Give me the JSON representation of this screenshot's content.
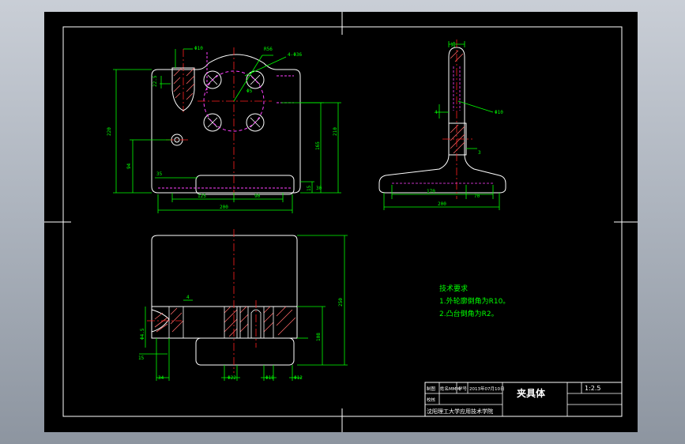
{
  "colors": {
    "background": "#000000",
    "frame": "#ffffff",
    "dimension": "#00ff00",
    "centerline": "#ff2020",
    "hidden": "#ff40ff",
    "section_hatch": "#ff6a6a",
    "notes": "#00ff00",
    "titleblock_text": "#ffffff"
  },
  "top_view_dims": {
    "d1": "Φ10",
    "d2": "R56",
    "d3": "4-Φ36",
    "d4": "Φ5",
    "d5": "22.5",
    "d6": "220",
    "d7": "210",
    "d8": "165",
    "d9": "94",
    "d10": "35",
    "d11": "125",
    "d12": "200",
    "d13": "90",
    "d14": "15",
    "d15": "30"
  },
  "side_view_dims": {
    "d1": "25",
    "d2": "4",
    "d3": "Φ10",
    "d4": "3",
    "d5": "170",
    "d6": "70",
    "d7": "200"
  },
  "front_view_dims": {
    "d1": "4",
    "d2": "Φ4.5",
    "d3": "15",
    "d4": "34",
    "d5": "Φ22",
    "d6": "Φ18",
    "d7": "Φ12",
    "d8": "250",
    "d9": "108"
  },
  "notes": {
    "heading": "技术要求",
    "line1": "1.外轮廓倒角为R10。",
    "line2": "2.凸台倒角为R2。"
  },
  "title_block": {
    "r1c1": "制图",
    "r1c2": "姓名MMM",
    "r1c3": "学号",
    "r1c4": "2013年07月10日",
    "r2c1": "校核",
    "drawing_name": "夹具体",
    "scale": "1:2.5",
    "school": "沈阳理工大学应用技术学院"
  }
}
